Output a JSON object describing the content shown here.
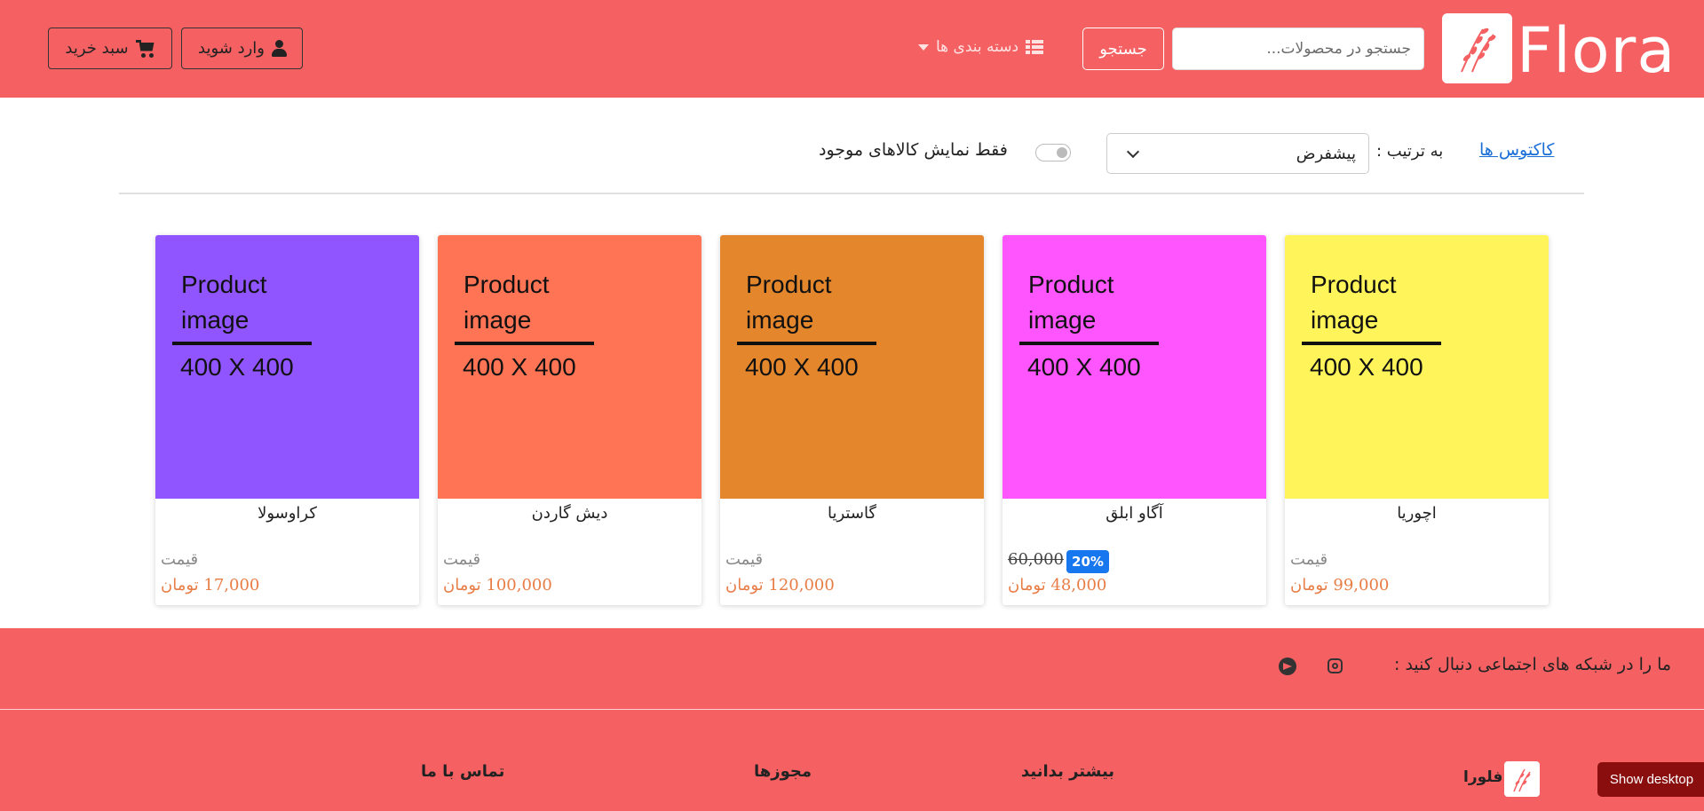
{
  "header": {
    "brand": "Flora",
    "search_placeholder": "جستجو در محصولات...",
    "search_button": "جستجو",
    "categories_label": "دسته بندی ها",
    "login_label": "وارد شوید",
    "cart_label": "سبد خرید",
    "icons": [
      "flower-logo-icon",
      "grid-icon",
      "caret-down-icon",
      "user-icon",
      "cart-icon"
    ]
  },
  "filters": {
    "breadcrumb": "کاکتوس ها",
    "sort_label": "به ترتیب :",
    "sort_value": "پیشفرض",
    "toggle_label": "فقط نمایش کالاهای موجود"
  },
  "products": [
    {
      "name": "اچوریا",
      "color": "#fff459",
      "img_line1": "Product",
      "img_line2": "image",
      "img_size": "400 X 400",
      "price_label": "قیمت",
      "price": "99,000 تومان"
    },
    {
      "name": "آگاو ابلق",
      "color": "#ff55ff",
      "img_line1": "Product",
      "img_line2": "image",
      "img_size": "400 X 400",
      "old_price": "60,000",
      "discount": "20%",
      "price": "48,000 تومان"
    },
    {
      "name": "گاستریا",
      "color": "#e3862c",
      "img_line1": "Product",
      "img_line2": "image",
      "img_size": "400 X 400",
      "price_label": "قیمت",
      "price": "120,000 تومان"
    },
    {
      "name": "دیش گاردن",
      "color": "#ff7455",
      "img_line1": "Product",
      "img_line2": "image",
      "img_size": "400 X 400",
      "price_label": "قیمت",
      "price": "100,000 تومان"
    },
    {
      "name": "کراوسولا",
      "color": "#9055ff",
      "img_line1": "Product",
      "img_line2": "image",
      "img_size": "400 X 400",
      "price_label": "قیمت",
      "price": "17,000 تومان"
    }
  ],
  "footer": {
    "social_text": "ما را در شبکه های اجتماعی دنبال کنید :",
    "brand": "فلورا",
    "col_more": "بیشتر بدانید",
    "col_licenses": "مجوزها",
    "col_contact": "تماس با ما"
  },
  "show_desktop": "Show desktop",
  "colors": {
    "brand": "#f56062",
    "price": "#e87d46",
    "link": "#1a6fd6",
    "badge": "#1677ee"
  }
}
